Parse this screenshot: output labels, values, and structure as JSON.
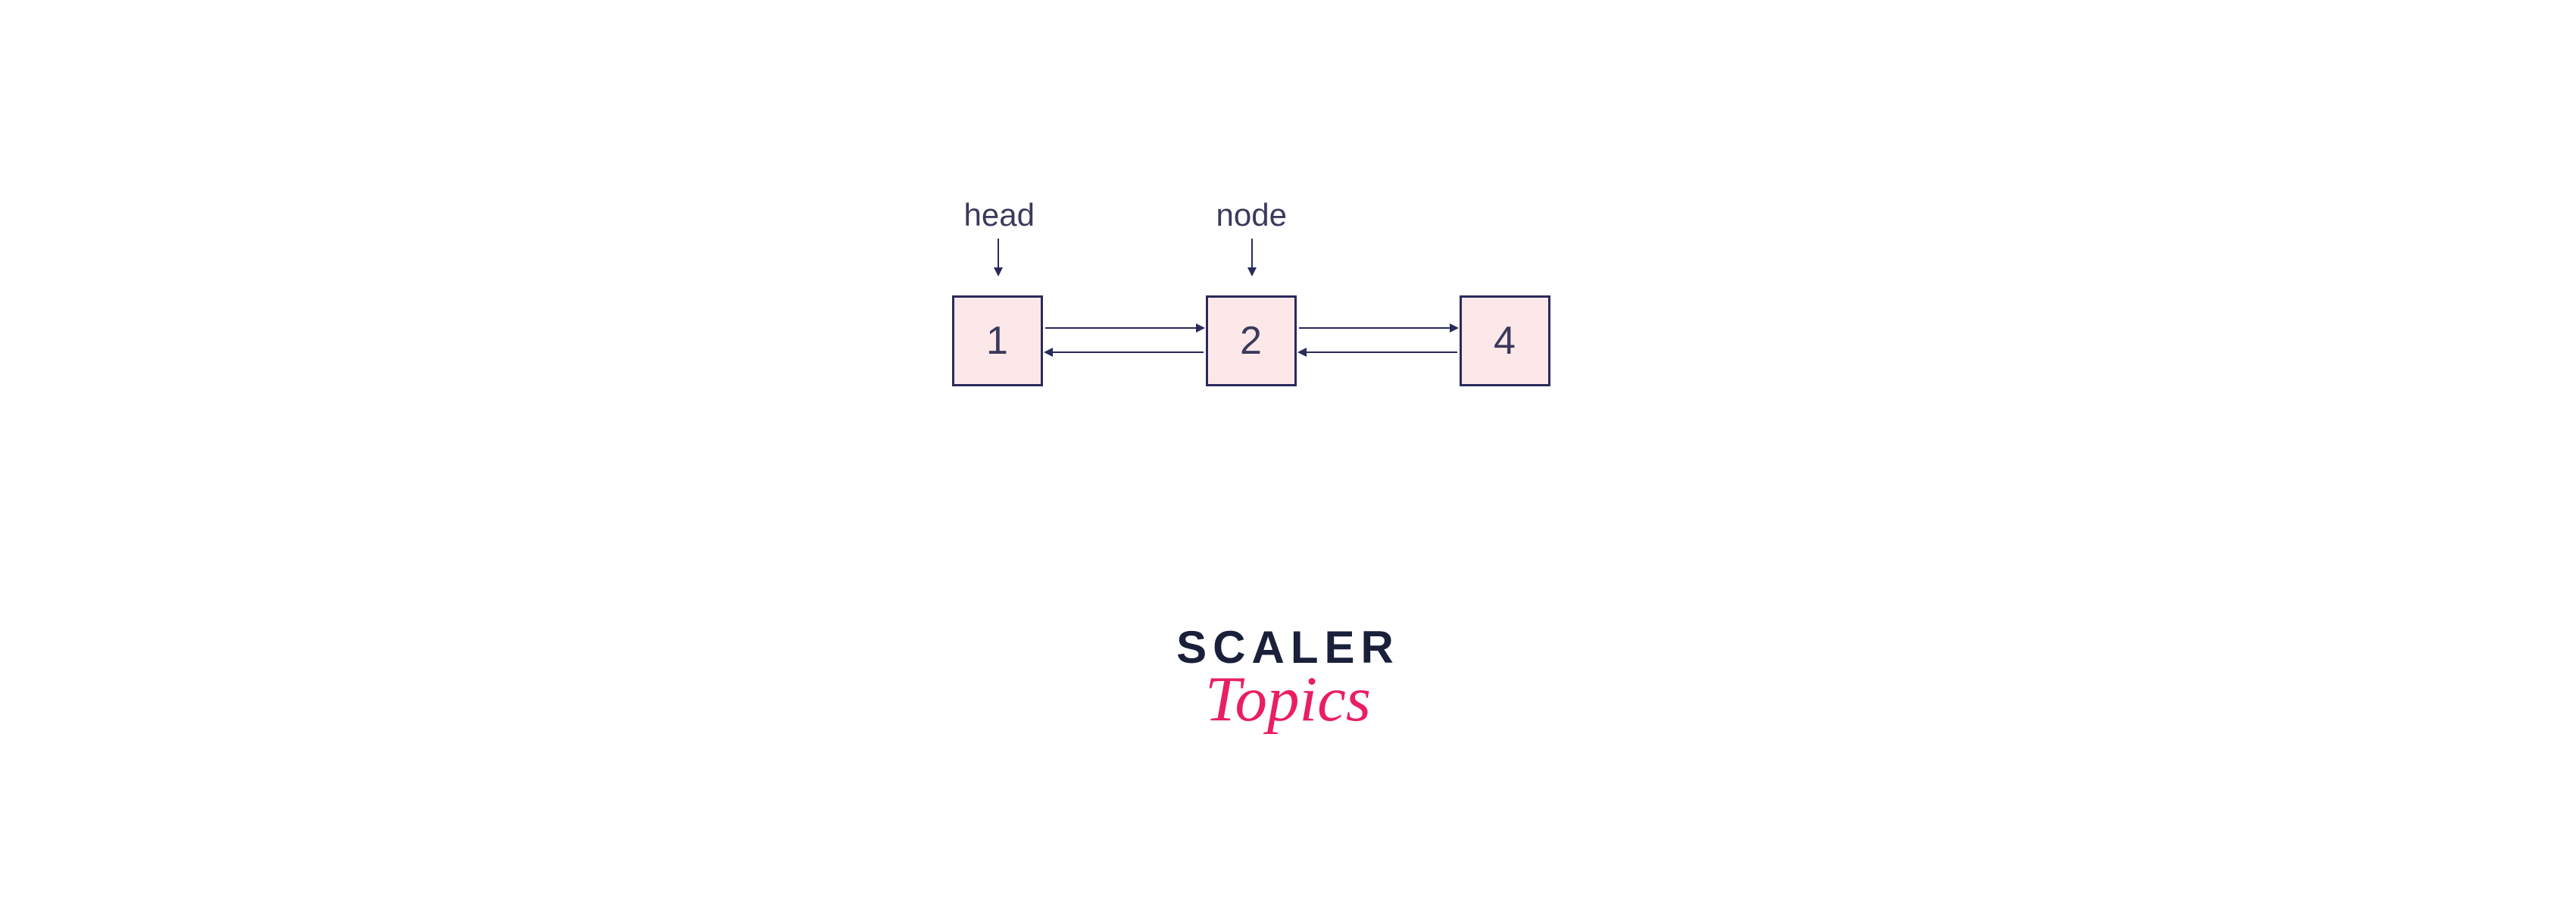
{
  "labels": {
    "head": "head",
    "node": "node"
  },
  "nodes": {
    "n1": "1",
    "n2": "2",
    "n3": "4"
  },
  "logo": {
    "line1": "SCALER",
    "line2": "Topics"
  }
}
